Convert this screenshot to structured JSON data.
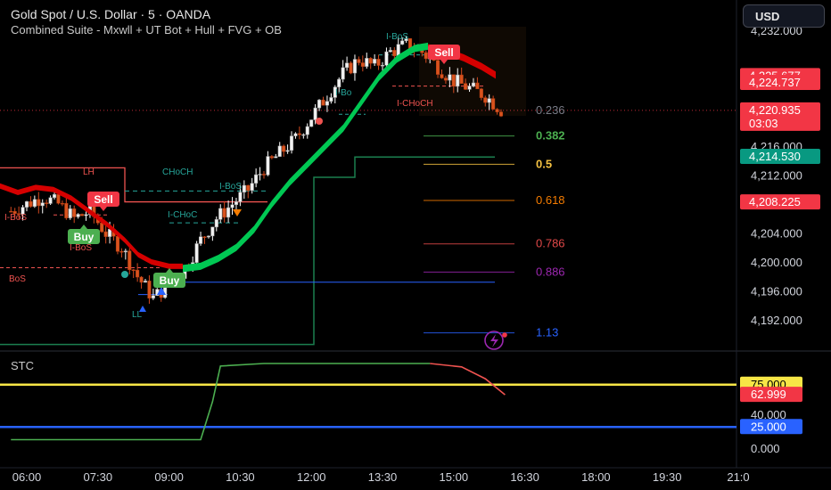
{
  "header": {
    "symbol_title": "Gold Spot / U.S. Dollar · 5 · OANDA",
    "indicator_title": "Combined Suite - Mxwll + UT Bot + Hull + FVG + OB"
  },
  "currency_button": {
    "label": "USD"
  },
  "stc_pane": {
    "label": "STC"
  },
  "price_axis": {
    "ticks": [
      {
        "price": 4232,
        "label": "4,232.000"
      },
      {
        "price": 4216,
        "label": "4,216.000"
      },
      {
        "price": 4212,
        "label": "4,212.000"
      },
      {
        "price": 4204,
        "label": "4,204.000"
      },
      {
        "price": 4200,
        "label": "4,200.000"
      },
      {
        "price": 4196,
        "label": "4,196.000"
      },
      {
        "price": 4192,
        "label": "4,192.000"
      }
    ],
    "badges": [
      {
        "price": 4225.677,
        "label": "4,225.677",
        "color": "#f23645"
      },
      {
        "price": 4224.737,
        "label": "4,224.737",
        "color": "#f23645"
      },
      {
        "price": 4220.935,
        "label": "4,220.935",
        "sub": "03:03",
        "color": "#f23645"
      },
      {
        "price": 4214.53,
        "label": "4,214.530",
        "color": "#089981"
      },
      {
        "price": 4208.225,
        "label": "4,208.225",
        "color": "#f23645"
      }
    ]
  },
  "stc_axis": {
    "ticks": [
      {
        "value": 40,
        "label": "40.000"
      },
      {
        "value": 0,
        "label": "0.000"
      }
    ],
    "badges": [
      {
        "value": 75,
        "label": "75.000",
        "color": "#f7e646",
        "text_color": "#000000"
      },
      {
        "value": 62.999,
        "label": "62.999",
        "color": "#f23645",
        "text_color": "#ffffff"
      },
      {
        "value": 25,
        "label": "25.000",
        "color": "#2962ff",
        "text_color": "#ffffff"
      }
    ]
  },
  "time_axis": {
    "labels": [
      "06:00",
      "07:30",
      "09:00",
      "10:30",
      "12:00",
      "13:30",
      "15:00",
      "16:30",
      "18:00",
      "19:30",
      "21:0"
    ]
  },
  "fib_levels": [
    {
      "label": "0.236",
      "price": 4220.935,
      "color": "#787b86"
    },
    {
      "label": "0.382",
      "price": 4217.4,
      "color": "#4caf50"
    },
    {
      "label": "0.5",
      "price": 4213.5,
      "color": "#f5c242"
    },
    {
      "label": "0.618",
      "price": 4208.5,
      "color": "#f57c00"
    },
    {
      "label": "0.786",
      "price": 4202.5,
      "color": "#e04848"
    },
    {
      "label": "0.886",
      "price": 4198.6,
      "color": "#9c27b0"
    },
    {
      "label": "1.13",
      "price": 4190.2,
      "color": "#2962ff"
    }
  ],
  "structure_labels": [
    {
      "text": "LH",
      "color": "#ef5350"
    },
    {
      "text": "I-BoS",
      "color": "#ef5350"
    },
    {
      "text": "I-BoS",
      "color": "#ef5350"
    },
    {
      "text": "BoS",
      "color": "#ef5350"
    },
    {
      "text": "CHoCH",
      "color": "#26a69a"
    },
    {
      "text": "I-BoS",
      "color": "#26a69a"
    },
    {
      "text": "I-CHoC",
      "color": "#26a69a"
    },
    {
      "text": "LL",
      "color": "#26a69a"
    },
    {
      "text": "I-BoS",
      "color": "#26a69a"
    },
    {
      "text": "I-Bo",
      "color": "#26a69a"
    },
    {
      "text": "I-CHoCH",
      "color": "#ef5350"
    }
  ],
  "signals": [
    {
      "type": "sell",
      "text": "Sell"
    },
    {
      "type": "buy",
      "text": "Buy"
    },
    {
      "type": "buy",
      "text": "Buy"
    },
    {
      "type": "sell",
      "text": "Sell"
    }
  ],
  "colors": {
    "bull": "#26a69a",
    "bear": "#ef5350",
    "hull_bull": "#00c853",
    "hull_bear": "#d50000",
    "stc_line": "#4caf50",
    "stc_down": "#ef5350",
    "stc_upper": "#f7e646",
    "stc_lower": "#2962ff"
  },
  "chart_data": {
    "type": "line",
    "title": "Gold Spot / U.S. Dollar · 5 · OANDA",
    "x": [
      "05:40",
      "06:00",
      "06:20",
      "06:40",
      "07:00",
      "07:20",
      "07:40",
      "08:00",
      "08:20",
      "08:40",
      "09:00",
      "09:20",
      "09:40",
      "10:00",
      "10:20",
      "10:40",
      "11:00",
      "11:20",
      "11:40",
      "12:00",
      "12:20",
      "12:40",
      "13:00",
      "13:20",
      "13:40",
      "14:00",
      "14:20",
      "14:40",
      "15:00",
      "15:20",
      "15:40",
      "16:00"
    ],
    "series": [
      {
        "values": [
          4207,
          4208,
          4209,
          4208,
          4206,
          4207,
          4204,
          4202,
          4198,
          4195,
          4197,
          4199,
          4203,
          4206,
          4208,
          4210,
          4213,
          4215,
          4217,
          4220,
          4223,
          4226,
          4228,
          4227,
          4229,
          4230,
          4229,
          4227,
          4225,
          4224,
          4223,
          4221
        ]
      }
    ],
    "ylim": [
      4189,
      4233
    ],
    "stc": {
      "x": [
        "05:40",
        "08:00",
        "09:40",
        "09:55",
        "10:05",
        "11:00",
        "14:30",
        "15:10",
        "15:40",
        "16:05"
      ],
      "values": [
        10,
        10,
        10,
        55,
        97,
        100,
        100,
        96,
        82,
        62.999
      ],
      "upper": 75,
      "lower": 25,
      "ylim": [
        -8,
        112
      ]
    }
  }
}
